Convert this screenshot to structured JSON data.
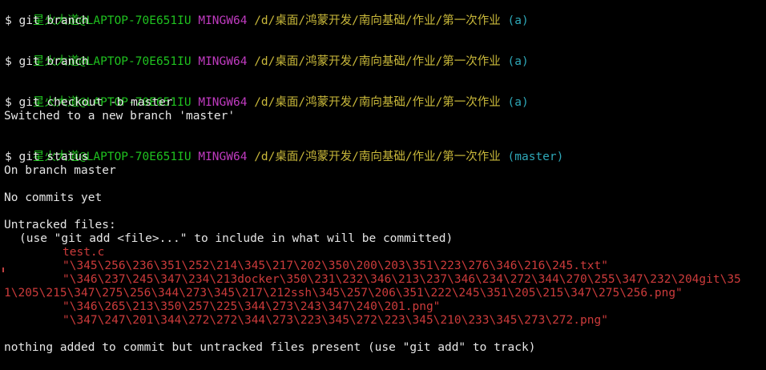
{
  "prompt": {
    "user": "星火大道@LAPTOP-70E651IU",
    "shell": "MINGW64",
    "path": "/d/桌面/鸿蒙开发/南向基础/作业/第一次作业"
  },
  "branches": [
    "(a)",
    "(a)",
    "(a)",
    "(master)"
  ],
  "commands": [
    "$ git branch",
    "$ git branch",
    "$ git checkout -b master",
    "$ git status"
  ],
  "output": {
    "switched": "Switched to a new branch 'master'",
    "on_branch": "On branch master",
    "no_commits": "No commits yet",
    "untracked_header": "Untracked files:",
    "untracked_hint": "(use \"git add <file>...\" to include in what will be committed)",
    "files": [
      "test.c",
      "\"\\345\\256\\236\\351\\252\\214\\345\\217\\202\\350\\200\\203\\351\\223\\276\\346\\216\\245.txt\"",
      "\"\\346\\237\\245\\347\\234\\213docker\\350\\231\\232\\346\\213\\237\\346\\234\\272\\344\\270\\255\\347\\232\\204git\\35",
      "1\\205\\215\\347\\275\\256\\344\\273\\345\\217\\212ssh\\345\\257\\206\\351\\222\\245\\351\\205\\215\\347\\275\\256.png\"",
      "\"\\346\\265\\213\\350\\257\\225\\344\\273\\243\\347\\240\\201.png\"",
      "\"\\347\\247\\201\\344\\272\\272\\344\\273\\223\\345\\272\\223\\345\\210\\233\\345\\273\\272.png\""
    ],
    "nothing_added": "nothing added to commit but untracked files present (use \"git add\" to track)"
  },
  "colors": {
    "user": "#1fc21f",
    "shell": "#c03bc0",
    "path": "#c9b83a",
    "branch": "#2ea8b8",
    "untracked": "#cc3b3b",
    "text": "#e6e6e6",
    "background": "#000000"
  }
}
